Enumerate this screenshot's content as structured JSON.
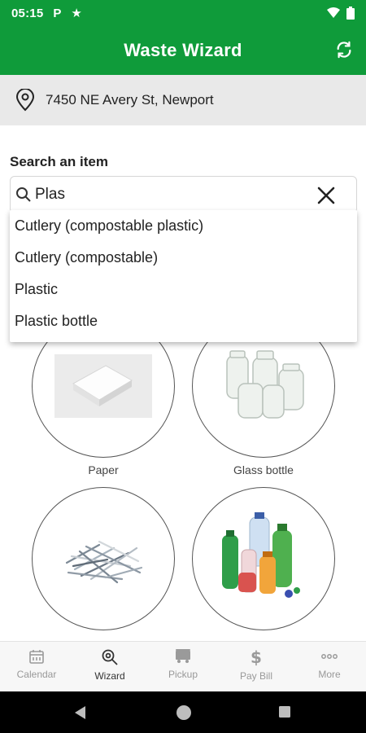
{
  "status_bar": {
    "time": "05:15",
    "notif1": "P",
    "notif2": "★"
  },
  "app_bar": {
    "title": "Waste Wizard",
    "action_icon": "refresh-icon"
  },
  "address": {
    "text": "7450 NE Avery St, Newport",
    "icon": "location-pin-icon"
  },
  "search": {
    "label": "Search an item",
    "value": "Plas",
    "icon": "search-icon",
    "clear_icon": "close-icon"
  },
  "suggestions": [
    "Cutlery (compostable plastic)",
    "Cutlery (compostable)",
    "Plastic",
    "Plastic bottle"
  ],
  "items": [
    {
      "label": "Paper",
      "image": "paper-stack"
    },
    {
      "label": "Glass bottle",
      "image": "glass-jars"
    },
    {
      "label": "",
      "image": "shredded-paper"
    },
    {
      "label": "",
      "image": "plastic-bottles"
    }
  ],
  "bottom_nav": [
    {
      "label": "Calendar",
      "icon": "calendar-icon",
      "active": false
    },
    {
      "label": "Wizard",
      "icon": "wizard-search-icon",
      "active": true
    },
    {
      "label": "Pickup",
      "icon": "truck-icon",
      "active": false
    },
    {
      "label": "Pay Bill",
      "icon": "dollar-icon",
      "active": false
    },
    {
      "label": "More",
      "icon": "more-icon",
      "active": false
    }
  ],
  "colors": {
    "primary": "#0f9b3a",
    "address_bg": "#e9e9e9"
  }
}
